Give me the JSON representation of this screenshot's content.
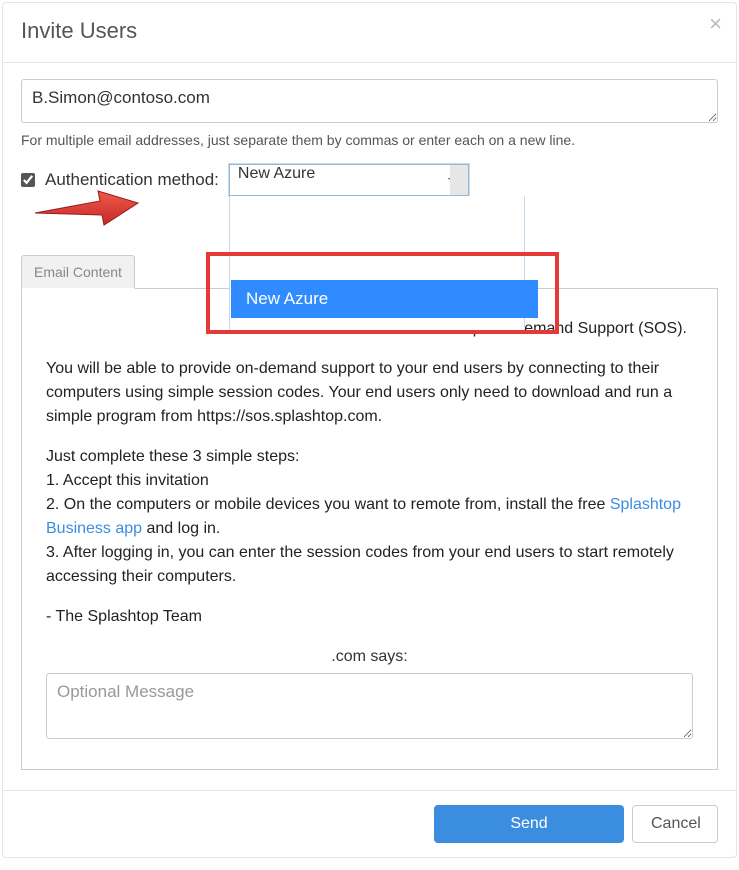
{
  "modal": {
    "title": "Invite Users",
    "close_label": "×"
  },
  "emails": {
    "value": "B.Simon@contoso.com",
    "help": "For multiple email addresses, just separate them by commas or enter each on a new line."
  },
  "auth": {
    "checked": true,
    "label": "Authentication method:",
    "selected": "New Azure",
    "dropdown_option": "New Azure"
  },
  "tab": {
    "label": "Email Content"
  },
  "email_body": {
    "p1_suffix": "ashtop On-Demand Support (SOS).",
    "p2": "You will be able to provide on-demand support to your end users by connecting to their computers using simple session codes. Your end users only need to download and run a simple program from https://sos.splashtop.com.",
    "steps_intro": "Just complete these 3 simple steps:",
    "step1": "1. Accept this invitation",
    "step2_prefix": "2. On the computers or mobile devices you want to remote from, install the free ",
    "step2_link": "Splashtop Business app",
    "step2_suffix": " and log in.",
    "step3": "3. After logging in, you can enter the session codes from your end users to start remotely accessing their computers.",
    "signoff": "- The Splashtop Team",
    "com_says": ".com says:",
    "optional_placeholder": "Optional Message"
  },
  "footer": {
    "send": "Send",
    "cancel": "Cancel"
  }
}
